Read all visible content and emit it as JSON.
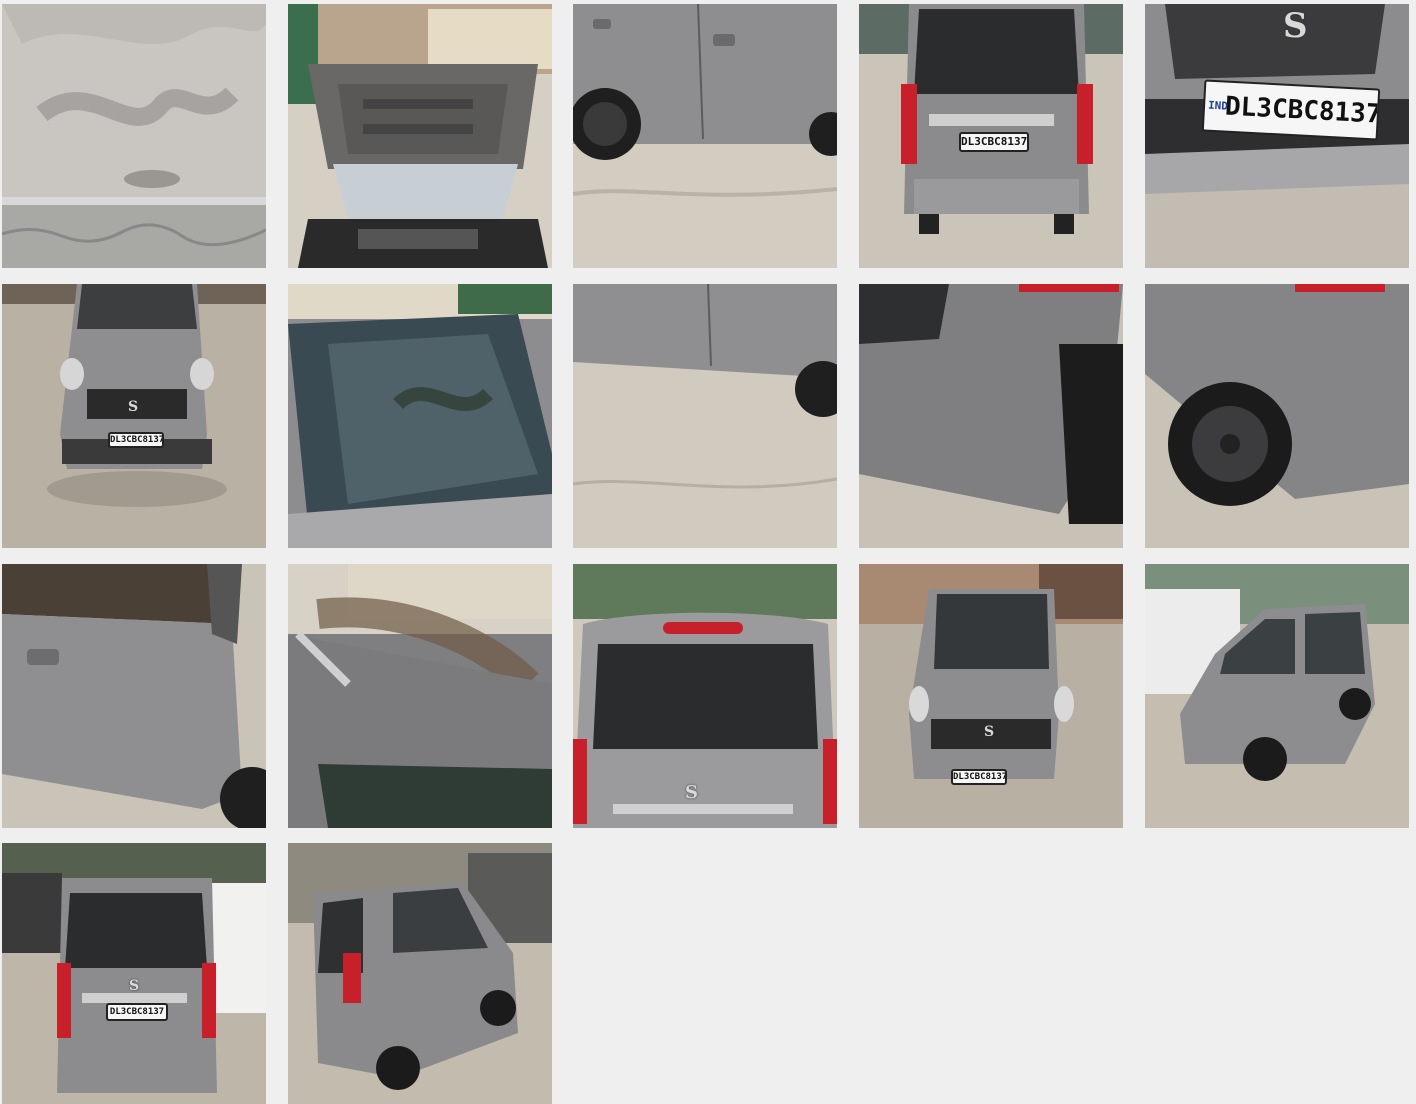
{
  "gallery": {
    "plate_text": "DL3CBC8137",
    "plate_prefix": "IND",
    "brand_glyph": "S",
    "colors": {
      "background": "#efefef",
      "car_body": "#8a8a8c",
      "ground": "#cfc8bc",
      "tail_light": "#c8202a"
    },
    "photos": [
      {
        "name": "photo-door-dent-closeup"
      },
      {
        "name": "photo-open-hood-engine"
      },
      {
        "name": "photo-right-doors-side"
      },
      {
        "name": "photo-rear-view"
      },
      {
        "name": "photo-front-bumper-plate-closeup"
      },
      {
        "name": "photo-front-view"
      },
      {
        "name": "photo-windshield-roof"
      },
      {
        "name": "photo-side-doors-lower"
      },
      {
        "name": "photo-rear-bumper-corner"
      },
      {
        "name": "photo-rear-wheel-arch"
      },
      {
        "name": "photo-front-door-interior"
      },
      {
        "name": "photo-roof-rails"
      },
      {
        "name": "photo-rear-hatch-closeup"
      },
      {
        "name": "photo-front-view-street"
      },
      {
        "name": "photo-front-three-quarter"
      },
      {
        "name": "photo-rear-view-van"
      },
      {
        "name": "photo-rear-three-quarter"
      }
    ]
  }
}
